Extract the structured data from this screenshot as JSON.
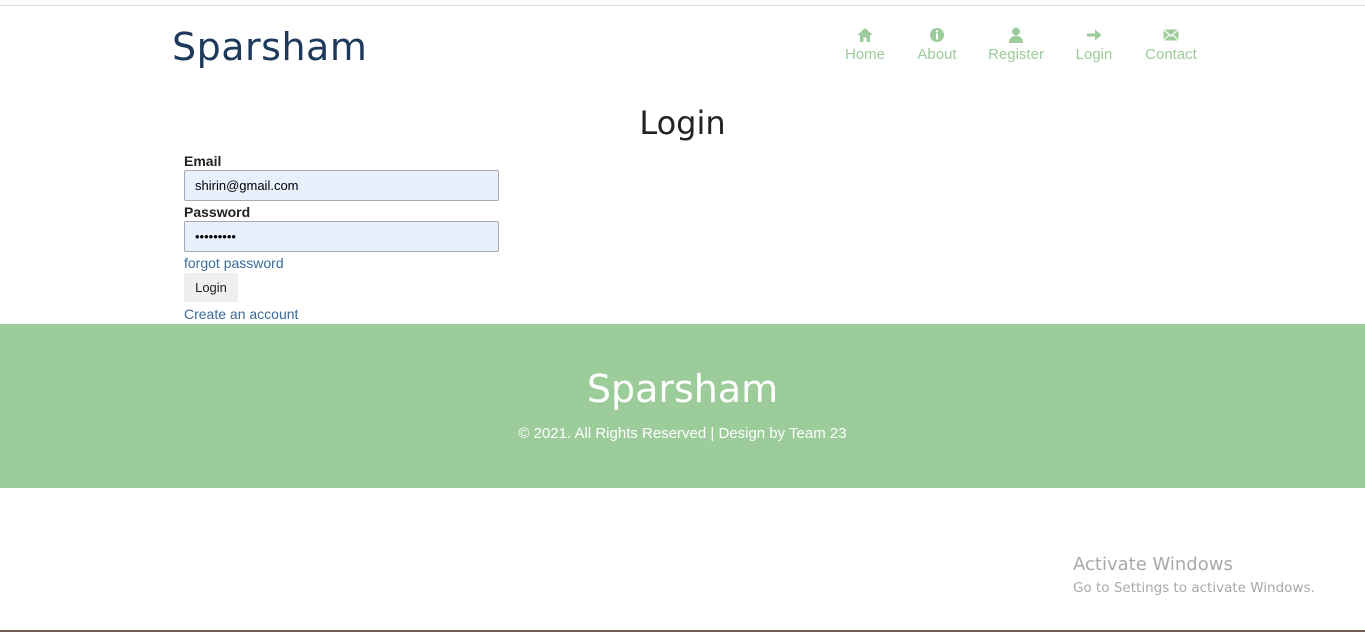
{
  "header": {
    "logo": "Sparsham",
    "nav": [
      {
        "label": "Home",
        "icon": "home-icon"
      },
      {
        "label": "About",
        "icon": "info-icon"
      },
      {
        "label": "Register",
        "icon": "user-icon"
      },
      {
        "label": "Login",
        "icon": "arrow-right-icon"
      },
      {
        "label": "Contact",
        "icon": "envelope-icon"
      }
    ]
  },
  "main": {
    "title": "Login",
    "email_label": "Email",
    "email_value": "shirin@gmail.com",
    "password_label": "Password",
    "password_value": "•••••••••",
    "forgot_link": "forgot password",
    "login_button": "Login",
    "create_link": "Create an account"
  },
  "footer": {
    "logo": "Sparsham",
    "copyright": "© 2021. All Rights Reserved | Design by Team 23"
  },
  "watermark": {
    "title": "Activate Windows",
    "subtitle": "Go to Settings to activate Windows."
  },
  "colors": {
    "accent_green": "#9bcc9a",
    "logo_navy": "#1d3a5c",
    "link_blue": "#3a6b9a",
    "input_bg": "#e8f0fe"
  }
}
